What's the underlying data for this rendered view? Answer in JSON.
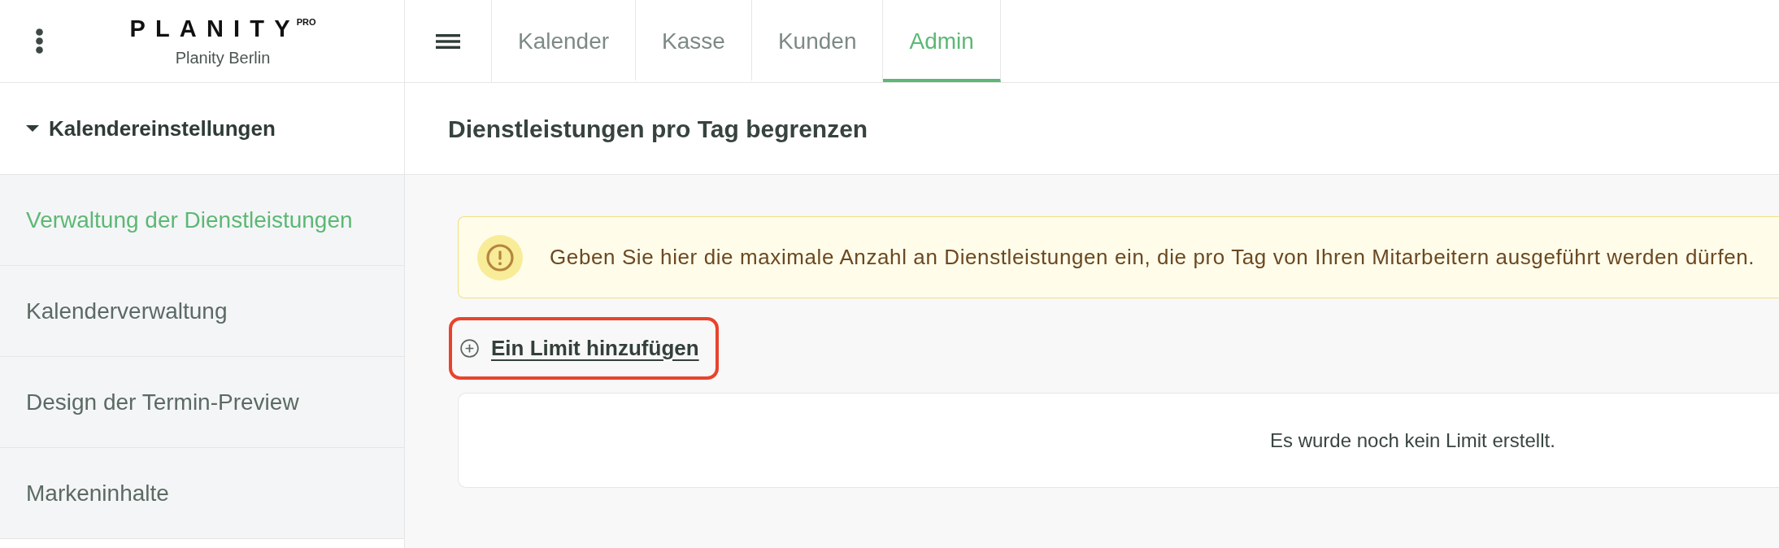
{
  "header": {
    "logo": {
      "wordmark": "PLANITY",
      "badge": "PRO"
    },
    "salon_name": "Planity Berlin"
  },
  "tabs": [
    {
      "label": "Kalender",
      "selected": false
    },
    {
      "label": "Kasse",
      "selected": false
    },
    {
      "label": "Kunden",
      "selected": false
    },
    {
      "label": "Admin",
      "selected": true
    }
  ],
  "sidebar": {
    "section_title": "Kalendereinstellungen",
    "expanded": true,
    "items": [
      {
        "label": "Verwaltung der Dienstleistungen",
        "selected": true
      },
      {
        "label": "Kalenderverwaltung",
        "selected": false
      },
      {
        "label": "Design der Termin-Preview",
        "selected": false
      },
      {
        "label": "Markeninhalte",
        "selected": false
      }
    ]
  },
  "page": {
    "title": "Dienstleistungen pro Tag begrenzen",
    "alert": {
      "text": "Geben Sie hier die maximale Anzahl an Dienstleistungen ein, die pro Tag von Ihren Mitarbeitern ausgeführt werden dürfen."
    },
    "add_link": {
      "label": "Ein Limit hinzufügen",
      "highlighted": true
    },
    "empty_state": "Es wurde noch kein Limit erstellt."
  }
}
